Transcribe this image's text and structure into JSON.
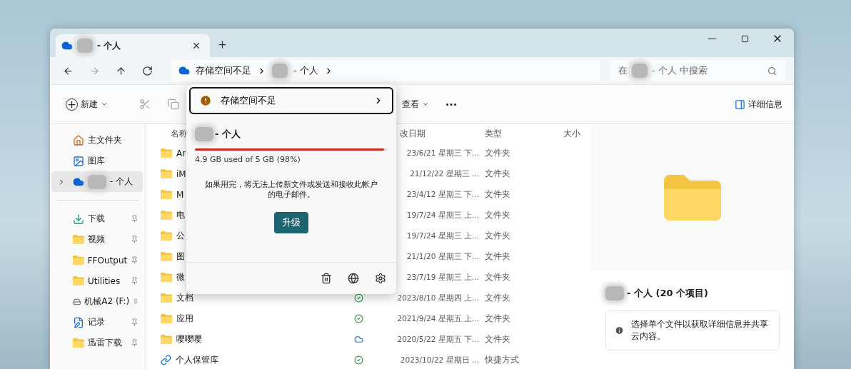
{
  "tab": {
    "title": "- 个人"
  },
  "address": {
    "segments": [
      "存储空间不足",
      "- 个人"
    ]
  },
  "search": {
    "placeholder_parts": [
      "在",
      "- 个人 中搜索"
    ]
  },
  "nav": [
    {
      "kind": "back",
      "disabled": false
    },
    {
      "kind": "forward",
      "disabled": true
    },
    {
      "kind": "up",
      "disabled": false
    },
    {
      "kind": "refresh",
      "disabled": false
    }
  ],
  "toolbar": [
    {
      "kind": "new",
      "label": "新建",
      "disabled": false
    },
    {
      "kind": "cut",
      "disabled": true
    },
    {
      "kind": "copy",
      "disabled": true
    },
    {
      "kind": "view",
      "label": "查看",
      "disabled": false
    },
    {
      "kind": "more",
      "disabled": false
    }
  ],
  "details_button": {
    "label": "详细信息"
  },
  "sidebar": {
    "top": [
      {
        "kind": "home",
        "label": "主文件夹",
        "selected": false
      },
      {
        "kind": "gallery",
        "label": "图库",
        "selected": false
      },
      {
        "kind": "cloud",
        "label": "- 个人",
        "selected": true,
        "expandable": true
      }
    ],
    "quick_access": [
      {
        "kind": "download",
        "label": "下载",
        "pinned": true
      },
      {
        "kind": "folder",
        "label": "视频",
        "pinned": true
      },
      {
        "kind": "folder",
        "label": "FFOutput",
        "pinned": true
      },
      {
        "kind": "folder",
        "label": "Utilities",
        "pinned": true
      },
      {
        "kind": "drive",
        "label": "机械A2 (F:)",
        "pinned": true
      },
      {
        "kind": "notes",
        "label": "记录",
        "pinned": true
      },
      {
        "kind": "folder",
        "label": "迅雷下载",
        "pinned": true
      }
    ]
  },
  "table": {
    "columns": [
      "名称",
      "改日期",
      "类型",
      "大小"
    ],
    "rows": [
      {
        "kind": "folder",
        "name": "Ar",
        "date": "23/6/21 星期三 下...",
        "type": "文件夹"
      },
      {
        "kind": "folder",
        "name": "iM",
        "date": "21/12/22 星期三 ...",
        "type": "文件夹"
      },
      {
        "kind": "folder",
        "name": "M",
        "date": "23/4/12 星期三 下...",
        "type": "文件夹"
      },
      {
        "kind": "folder",
        "name": "电",
        "date": "19/7/24 星期三 上...",
        "type": "文件夹"
      },
      {
        "kind": "folder",
        "name": "公",
        "date": "19/7/24 星期三 上...",
        "type": "文件夹"
      },
      {
        "kind": "folder",
        "name": "图",
        "date": "21/1/20 星期三 下...",
        "type": "文件夹"
      },
      {
        "kind": "folder",
        "name": "微",
        "date": "23/7/19 星期三 上...",
        "type": "文件夹"
      },
      {
        "kind": "folder",
        "name": "文档",
        "synced": true,
        "date": "2023/8/10 星期四 上...",
        "type": "文件夹"
      },
      {
        "kind": "folder",
        "name": "应用",
        "synced": true,
        "date": "2021/9/24 星期五 上...",
        "type": "文件夹"
      },
      {
        "kind": "folder",
        "name": "嘤嘤嘤",
        "synced": false,
        "date": "2020/5/22 星期五 下...",
        "type": "文件夹"
      },
      {
        "kind": "shortcut",
        "name": "个人保管库",
        "synced": true,
        "date": "2023/10/22 星期日 ...",
        "type": "快捷方式"
      }
    ]
  },
  "details": {
    "title": "- 个人 (20 个项目)",
    "info": "选择单个文件以获取详细信息并共享云内容。"
  },
  "popup": {
    "warning": "存储空间不足",
    "account": "- 个人",
    "level": 0.98,
    "usage": "4.9 GB used of 5 GB (98%)",
    "message": "如果用完，将无法上传新文件或发送和接收此帐户的电子邮件。",
    "button": "升级"
  }
}
